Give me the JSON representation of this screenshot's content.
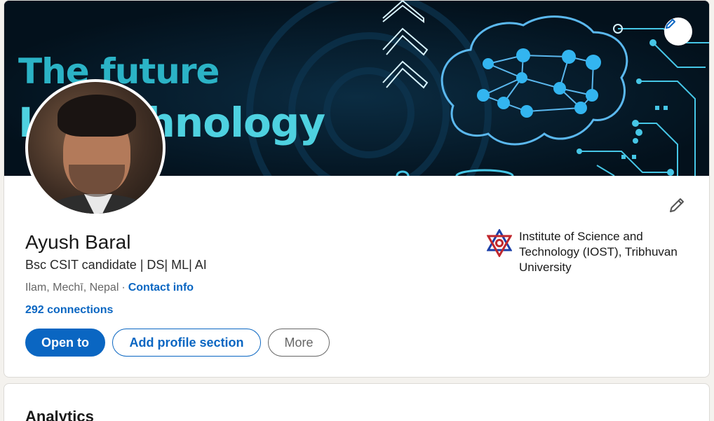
{
  "banner": {
    "line1": "The future",
    "line2": "In Technology",
    "edit_icon": "pencil-icon",
    "colors": {
      "background": "#051a2a",
      "accent": "#4ed1e0"
    }
  },
  "profile": {
    "name": "Ayush Baral",
    "headline": "Bsc CSIT candidate | DS| ML| AI",
    "location": "Ilam, Mechī, Nepal",
    "separator": "·",
    "contact_label": "Contact info",
    "connections": "292 connections",
    "edit_icon": "pencil-icon"
  },
  "actions": {
    "open_to": "Open to",
    "add_section": "Add profile section",
    "more": "More"
  },
  "education": {
    "name": "Institute of Science and Technology (IOST), Tribhuvan University",
    "logo_icon": "university-seal-icon"
  },
  "analytics": {
    "title": "Analytics"
  },
  "colors": {
    "brand": "#0a66c2"
  }
}
